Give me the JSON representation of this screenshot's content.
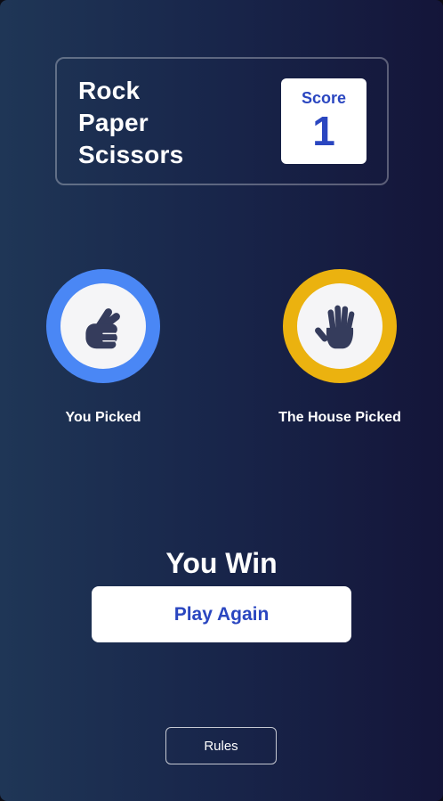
{
  "header": {
    "title_lines": [
      "Rock",
      "Paper",
      "Scissors"
    ],
    "score_label": "Score",
    "score_value": "1"
  },
  "player": {
    "label": "You Picked",
    "choice_icon": "scissors-hand-icon",
    "ring_color": "#4a87f5"
  },
  "house": {
    "label": "The House Picked",
    "choice_icon": "paper-hand-icon",
    "ring_color": "#ebb20f"
  },
  "result": {
    "text": "You Win",
    "play_again_label": "Play Again"
  },
  "footer": {
    "rules_label": "Rules"
  },
  "colors": {
    "accent_text": "#2a46c0",
    "icon": "#353c5c"
  }
}
